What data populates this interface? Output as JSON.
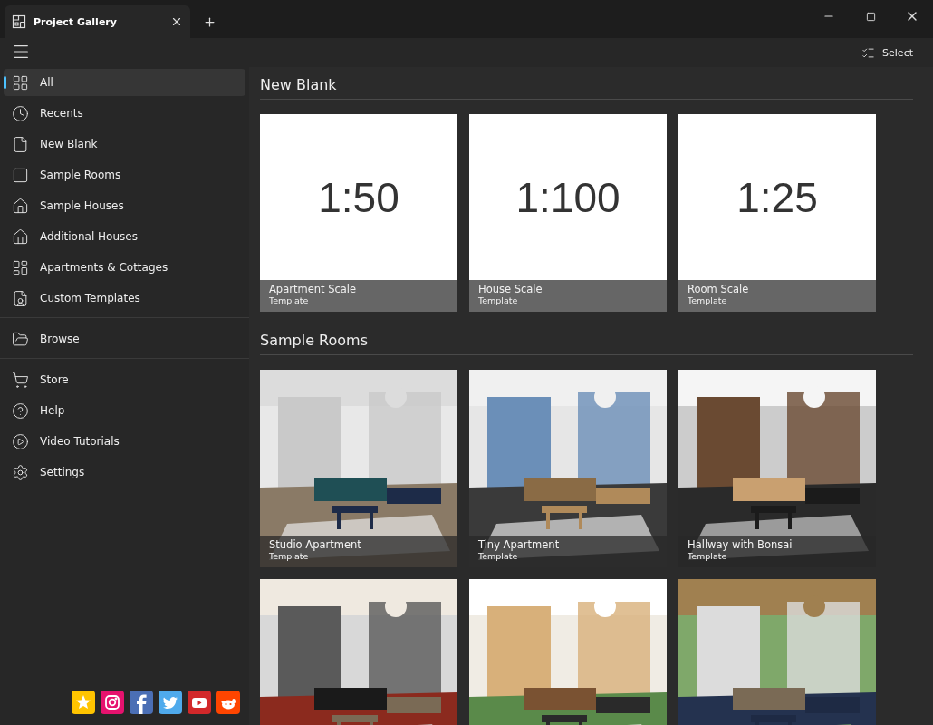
{
  "window": {
    "tab_title": "Project Gallery"
  },
  "toolbar": {
    "select_label": "Select"
  },
  "sidebar": {
    "groups": [
      [
        {
          "label": "All",
          "selected": true
        },
        {
          "label": "Recents",
          "selected": false
        },
        {
          "label": "New Blank",
          "selected": false
        },
        {
          "label": "Sample Rooms",
          "selected": false
        },
        {
          "label": "Sample Houses",
          "selected": false
        },
        {
          "label": "Additional Houses",
          "selected": false
        },
        {
          "label": "Apartments & Cottages",
          "selected": false
        },
        {
          "label": "Custom Templates",
          "selected": false
        }
      ],
      [
        {
          "label": "Browse",
          "selected": false
        }
      ],
      [
        {
          "label": "Store",
          "selected": false
        },
        {
          "label": "Help",
          "selected": false
        },
        {
          "label": "Video Tutorials",
          "selected": false
        },
        {
          "label": "Settings",
          "selected": false
        }
      ]
    ]
  },
  "social": [
    {
      "kind": "star",
      "color": "#ffc400"
    },
    {
      "kind": "instagram",
      "color": "#e6126e"
    },
    {
      "kind": "facebook",
      "color": "#4b6fb5"
    },
    {
      "kind": "twitter",
      "color": "#4faaec"
    },
    {
      "kind": "youtube",
      "color": "#d2282a"
    },
    {
      "kind": "reddit",
      "color": "#ff4500"
    }
  ],
  "sections": [
    {
      "title": "New Blank",
      "tiles": [
        {
          "kind": "scale",
          "scale": "1:50",
          "name": "Apartment Scale",
          "subtitle": "Template"
        },
        {
          "kind": "scale",
          "scale": "1:100",
          "name": "House Scale",
          "subtitle": "Template"
        },
        {
          "kind": "scale",
          "scale": "1:25",
          "name": "Room Scale",
          "subtitle": "Template"
        }
      ]
    },
    {
      "title": "Sample Rooms",
      "tiles": [
        {
          "kind": "picture",
          "name": "Studio Apartment",
          "subtitle": "Template"
        },
        {
          "kind": "picture",
          "name": "Tiny Apartment",
          "subtitle": "Template"
        },
        {
          "kind": "picture",
          "name": "Hallway with Bonsai",
          "subtitle": "Template"
        },
        {
          "kind": "picture"
        },
        {
          "kind": "picture"
        },
        {
          "kind": "picture"
        }
      ]
    }
  ]
}
